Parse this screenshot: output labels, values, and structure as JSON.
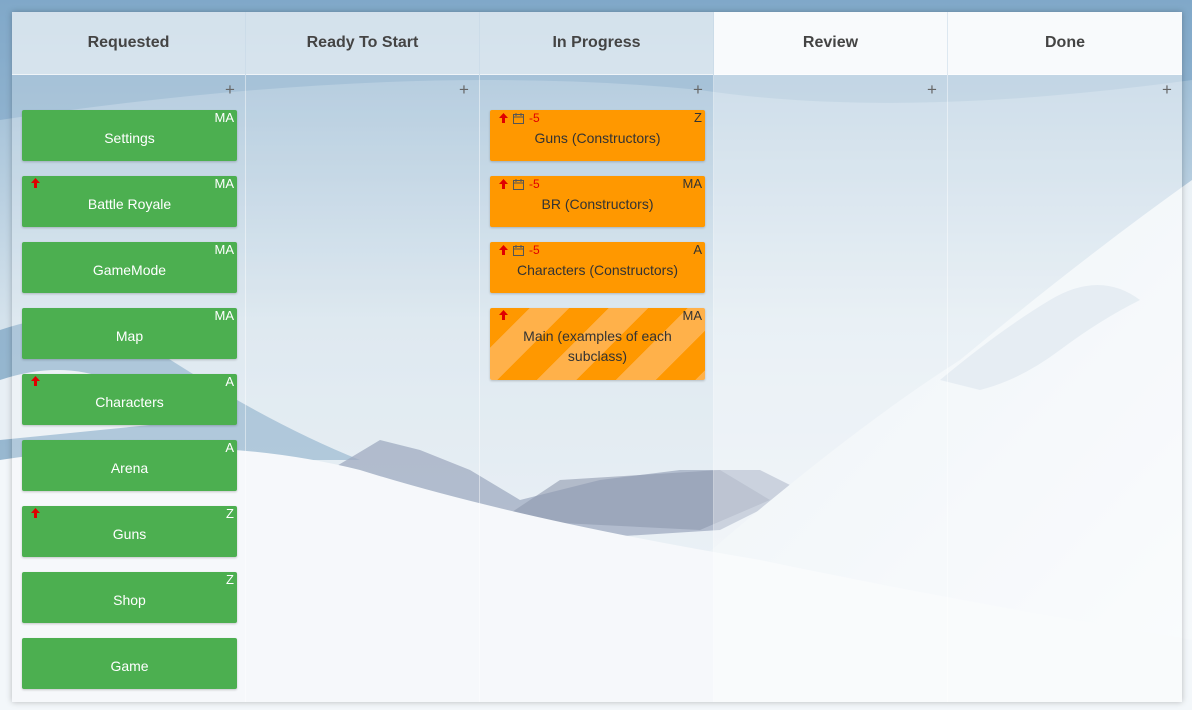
{
  "columns": [
    {
      "title": "Requested",
      "add_label": "+",
      "cards": [
        {
          "title": "Settings",
          "assignee": "MA",
          "priority": false,
          "due": ""
        },
        {
          "title": "Battle Royale",
          "assignee": "MA",
          "priority": true,
          "due": ""
        },
        {
          "title": "GameMode",
          "assignee": "MA",
          "priority": false,
          "due": ""
        },
        {
          "title": "Map",
          "assignee": "MA",
          "priority": false,
          "due": ""
        },
        {
          "title": "Characters",
          "assignee": "A",
          "priority": true,
          "due": ""
        },
        {
          "title": "Arena",
          "assignee": "A",
          "priority": false,
          "due": ""
        },
        {
          "title": "Guns",
          "assignee": "Z",
          "priority": true,
          "due": ""
        },
        {
          "title": "Shop",
          "assignee": "Z",
          "priority": false,
          "due": ""
        },
        {
          "title": "Game",
          "assignee": "",
          "priority": false,
          "due": ""
        }
      ]
    },
    {
      "title": "Ready To Start",
      "add_label": "+",
      "cards": []
    },
    {
      "title": "In Progress",
      "add_label": "+",
      "cards": [
        {
          "title": "Guns (Constructors)",
          "assignee": "Z",
          "priority": true,
          "due": "-5"
        },
        {
          "title": "BR (Constructors)",
          "assignee": "MA",
          "priority": true,
          "due": "-5"
        },
        {
          "title": "Characters (Constructors)",
          "assignee": "A",
          "priority": true,
          "due": "-5"
        },
        {
          "title": "Main (examples of each subclass)",
          "assignee": "MA",
          "priority": true,
          "due": "",
          "striped": true
        }
      ]
    },
    {
      "title": "Review",
      "add_label": "+",
      "cards": []
    },
    {
      "title": "Done",
      "add_label": "+",
      "cards": []
    }
  ],
  "colors": {
    "requested_card": "#4caf50",
    "in_progress_card": "#ff9800",
    "priority_arrow": "#e00000",
    "due_overdue": "#e00000"
  },
  "icons": {
    "priority": "arrow-up-icon",
    "due_date": "calendar-icon",
    "add": "plus-icon"
  }
}
